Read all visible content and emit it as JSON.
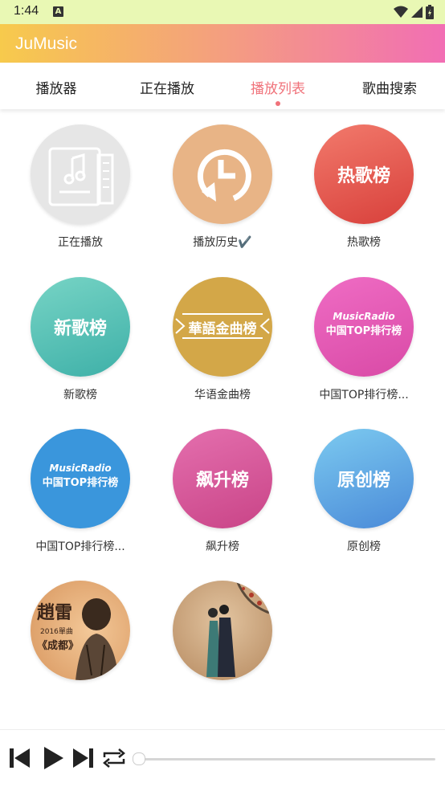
{
  "status": {
    "time": "1:44",
    "badge": "A"
  },
  "app": {
    "title": "JuMusic"
  },
  "tabs": [
    {
      "label": "播放器"
    },
    {
      "label": "正在播放"
    },
    {
      "label": "播放列表",
      "active": true
    },
    {
      "label": "歌曲搜索"
    }
  ],
  "playlists": [
    {
      "label": "正在播放",
      "icon": "document-music-icon",
      "color": "#e6e6e6"
    },
    {
      "label": "播放历史✔️",
      "icon": "history-clock-icon",
      "color": "#e8b486"
    },
    {
      "label": "热歌榜",
      "cover_text": "热歌榜",
      "color": "#e3524b"
    },
    {
      "label": "新歌榜",
      "cover_text": "新歌榜",
      "color": "#4ec1b6"
    },
    {
      "label": "华语金曲榜",
      "cover_text": "華語金曲榜",
      "color": "#d3a748"
    },
    {
      "label": "中国TOP排行榜...",
      "cover_line1": "MusicRadio",
      "cover_line2": "中国TOP排行榜",
      "color": "#e659b7"
    },
    {
      "label": "中国TOP排行榜...",
      "cover_line1": "MusicRadio",
      "cover_line2": "中国TOP排行榜",
      "color": "#3a96dc"
    },
    {
      "label": "飙升榜",
      "cover_text": "飙升榜",
      "color": "#d4568f"
    },
    {
      "label": "原创榜",
      "cover_text": "原创榜",
      "color": "#5aa2e0"
    },
    {
      "label": "",
      "cover_text": "趙雷",
      "cover_sub": "2016單曲",
      "cover_sub2": "《成都》",
      "color": "#e9b07a"
    },
    {
      "label": "",
      "color": "#c8a27a"
    }
  ],
  "player": {
    "progress": 0
  },
  "icons": [
    "skip-previous-icon",
    "play-icon",
    "skip-next-icon",
    "repeat-icon"
  ]
}
